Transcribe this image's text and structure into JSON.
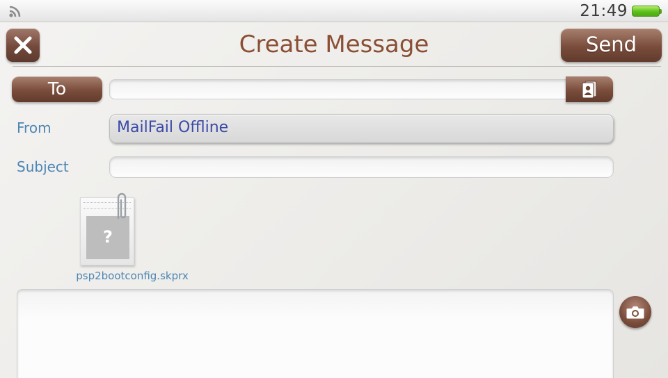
{
  "status_bar": {
    "time": "21:49",
    "wifi_icon": "wifi-icon",
    "battery_icon": "battery-icon",
    "battery_color": "#5cbf1c"
  },
  "header": {
    "title": "Create Message",
    "close_icon": "close-icon",
    "send_label": "Send"
  },
  "form": {
    "to_label": "To",
    "to_value": "",
    "contacts_icon": "contacts-icon",
    "from_label": "From",
    "from_value": "MailFail Offline",
    "subject_label": "Subject",
    "subject_value": ""
  },
  "attachment": {
    "file_name": "psp2bootconfig.skprx",
    "file_icon_glyph": "?",
    "paperclip_icon": "paperclip-icon"
  },
  "body": {
    "message_text": "",
    "camera_icon": "camera-icon"
  },
  "colors": {
    "accent_brown": "#7a4c3b",
    "title_brown": "#8a4f35",
    "label_blue": "#4c86b3",
    "from_text_blue": "#3b4aa6"
  }
}
